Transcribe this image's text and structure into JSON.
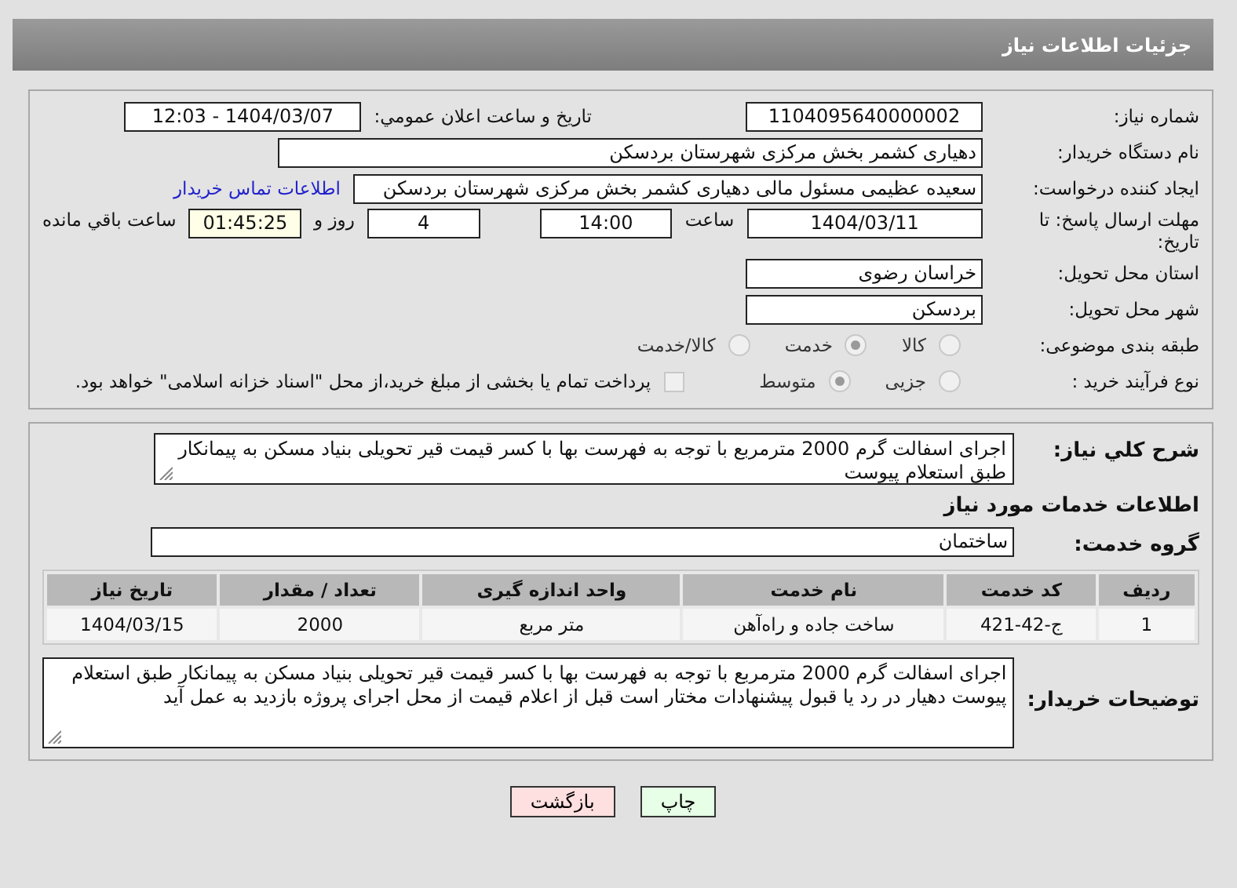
{
  "header": {
    "title": "جزئیات اطلاعات نیاز"
  },
  "details": {
    "need_number": {
      "label": "شماره نیاز:",
      "value": "1104095640000002"
    },
    "announce": {
      "label": "تاریخ و ساعت اعلان عمومي:",
      "value": "1404/03/07 - 12:03"
    },
    "buyer": {
      "label": "نام دستگاه خریدار:",
      "value": "دهیاری کشمر بخش مرکزی شهرستان بردسکن"
    },
    "creator": {
      "label": "ایجاد کننده درخواست:",
      "value": "سعیده عظیمی مسئول مالی دهیاری کشمر بخش مرکزی شهرستان بردسکن",
      "link": "اطلاعات تماس خریدار"
    },
    "deadline": {
      "label": "مهلت ارسال پاسخ: تا تاریخ:",
      "date": "1404/03/11",
      "time_label": "ساعت",
      "time": "14:00",
      "days": "4",
      "days_label": "روز و",
      "remaining": "01:45:25",
      "remaining_label": "ساعت باقي مانده"
    },
    "province": {
      "label": "استان محل تحویل:",
      "value": "خراسان رضوی"
    },
    "city": {
      "label": "شهر محل تحویل:",
      "value": "بردسکن"
    },
    "category": {
      "label": "طبقه بندی موضوعی:",
      "options": [
        {
          "label": "کالا",
          "selected": false
        },
        {
          "label": "خدمت",
          "selected": true
        },
        {
          "label": "کالا/خدمت",
          "selected": false
        }
      ]
    },
    "process": {
      "label": "نوع فرآیند خرید :",
      "options": [
        {
          "label": "جزیی",
          "selected": false
        },
        {
          "label": "متوسط",
          "selected": true
        }
      ],
      "payment": {
        "label": "پرداخت تمام یا بخشی از مبلغ خرید،از محل \"اسناد خزانه اسلامی\" خواهد بود.",
        "checked": false
      }
    }
  },
  "services": {
    "summary": {
      "label": "شرح کلي نیاز:",
      "value": "اجرای اسفالت گرم 2000 مترمربع با توجه به فهرست بها با کسر قیمت قیر تحویلی بنیاد مسکن به پیمانکار طبق استعلام پیوست"
    },
    "heading": "اطلاعات خدمات مورد نیاز",
    "group": {
      "label": "گروه خدمت:",
      "value": "ساختمان"
    },
    "table": {
      "columns": [
        "ردیف",
        "کد خدمت",
        "نام خدمت",
        "واحد اندازه گیری",
        "تعداد / مقدار",
        "تاریخ نیاز"
      ],
      "rows": [
        [
          "1",
          "ج-42-421",
          "ساخت جاده و راه‌آهن",
          "متر مربع",
          "2000",
          "1404/03/15"
        ]
      ]
    },
    "notes": {
      "label": "توضیحات خریدار:",
      "value": "اجرای اسفالت گرم 2000 مترمربع با توجه به فهرست بها با کسر قیمت قیر تحویلی بنیاد مسکن به پیمانکار طبق استعلام پیوست دهیار در رد یا قبول پیشنهادات مختار است قبل از اعلام قیمت از محل اجرای پروژه بازدید به عمل آید"
    }
  },
  "buttons": [
    {
      "label": "چاپ",
      "kind": "print"
    },
    {
      "label": "بازگشت",
      "kind": "back"
    }
  ]
}
